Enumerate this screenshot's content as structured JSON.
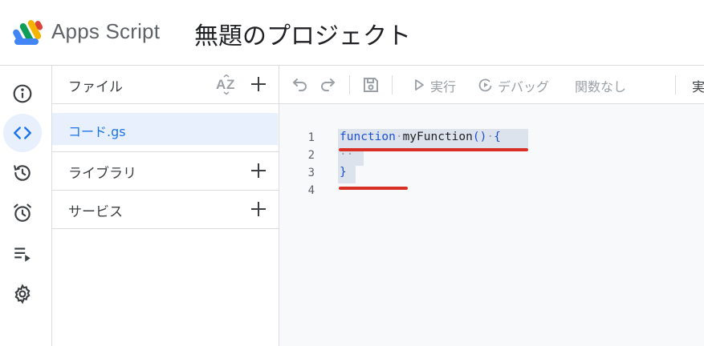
{
  "header": {
    "app_name": "Apps Script",
    "project_name": "無題のプロジェクト"
  },
  "rail": {
    "items": [
      {
        "icon": "info-icon"
      },
      {
        "icon": "code-icon",
        "active": true
      },
      {
        "icon": "history-icon"
      },
      {
        "icon": "alarm-icon"
      },
      {
        "icon": "playlist-icon"
      },
      {
        "icon": "gear-icon"
      }
    ]
  },
  "files": {
    "title": "ファイル",
    "items": [
      {
        "label": "コード.gs",
        "selected": true
      }
    ],
    "libraries_label": "ライブラリ",
    "services_label": "サービス"
  },
  "toolbar": {
    "run_label": "実行",
    "debug_label": "デバッグ",
    "function_label": "関数なし",
    "overflow_label": "実"
  },
  "editor": {
    "line_numbers": [
      "1",
      "2",
      "3",
      "4"
    ],
    "line1": {
      "keyword": "function",
      "space": "·",
      "name": "myFunction",
      "parens": "()",
      "space2": "·",
      "brace": "{"
    },
    "line2": {
      "indent": "··"
    },
    "line3": {
      "brace": "}"
    }
  },
  "colors": {
    "accent": "#1a73e8",
    "selection": "#e8f0fe",
    "annotation": "#d93025"
  }
}
